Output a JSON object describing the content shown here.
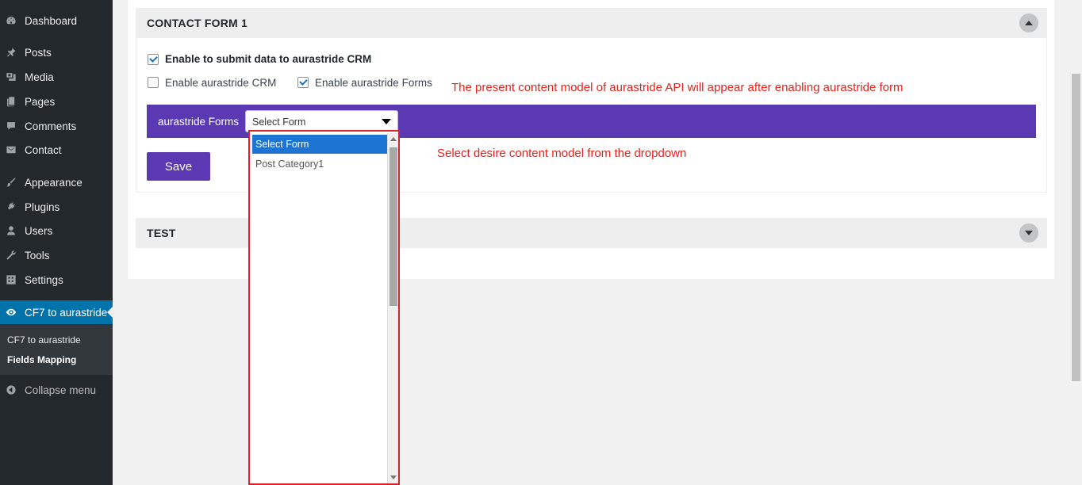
{
  "sidebar": {
    "items": [
      {
        "label": "Dashboard",
        "icon": "dashboard-icon"
      },
      {
        "label": "Posts",
        "icon": "pin-icon"
      },
      {
        "label": "Media",
        "icon": "media-icon"
      },
      {
        "label": "Pages",
        "icon": "pages-icon"
      },
      {
        "label": "Comments",
        "icon": "comment-icon"
      },
      {
        "label": "Contact",
        "icon": "mail-icon"
      },
      {
        "label": "Appearance",
        "icon": "brush-icon"
      },
      {
        "label": "Plugins",
        "icon": "plug-icon"
      },
      {
        "label": "Users",
        "icon": "user-icon"
      },
      {
        "label": "Tools",
        "icon": "wrench-icon"
      },
      {
        "label": "Settings",
        "icon": "settings-icon"
      },
      {
        "label": "CF7 to aurastride",
        "icon": "eye-icon"
      }
    ],
    "submenu": [
      "CF7 to aurastride",
      "Fields Mapping"
    ],
    "collapse_label": "Collapse menu"
  },
  "sections": {
    "contact_form": {
      "title": "CONTACT FORM 1"
    },
    "test": {
      "title": "TEST"
    }
  },
  "options": {
    "submit_data_label": "Enable to submit data to aurastride CRM",
    "crm_label": "Enable aurastride CRM",
    "forms_label": "Enable aurastride Forms"
  },
  "annotations": {
    "content_model": "The present content model of aurastride API will appear after enabling aurastride form",
    "select_desire": "Select desire content model from the dropdown"
  },
  "forms_bar": {
    "label": "aurastride Forms",
    "selected": "Select Form",
    "options": [
      "Select Form",
      "Post Category1"
    ]
  },
  "save_label": "Save",
  "colors": {
    "sidebar": "#23282d",
    "active": "#0073aa",
    "accent": "#5a39b3",
    "annotation": "#e8221b"
  }
}
